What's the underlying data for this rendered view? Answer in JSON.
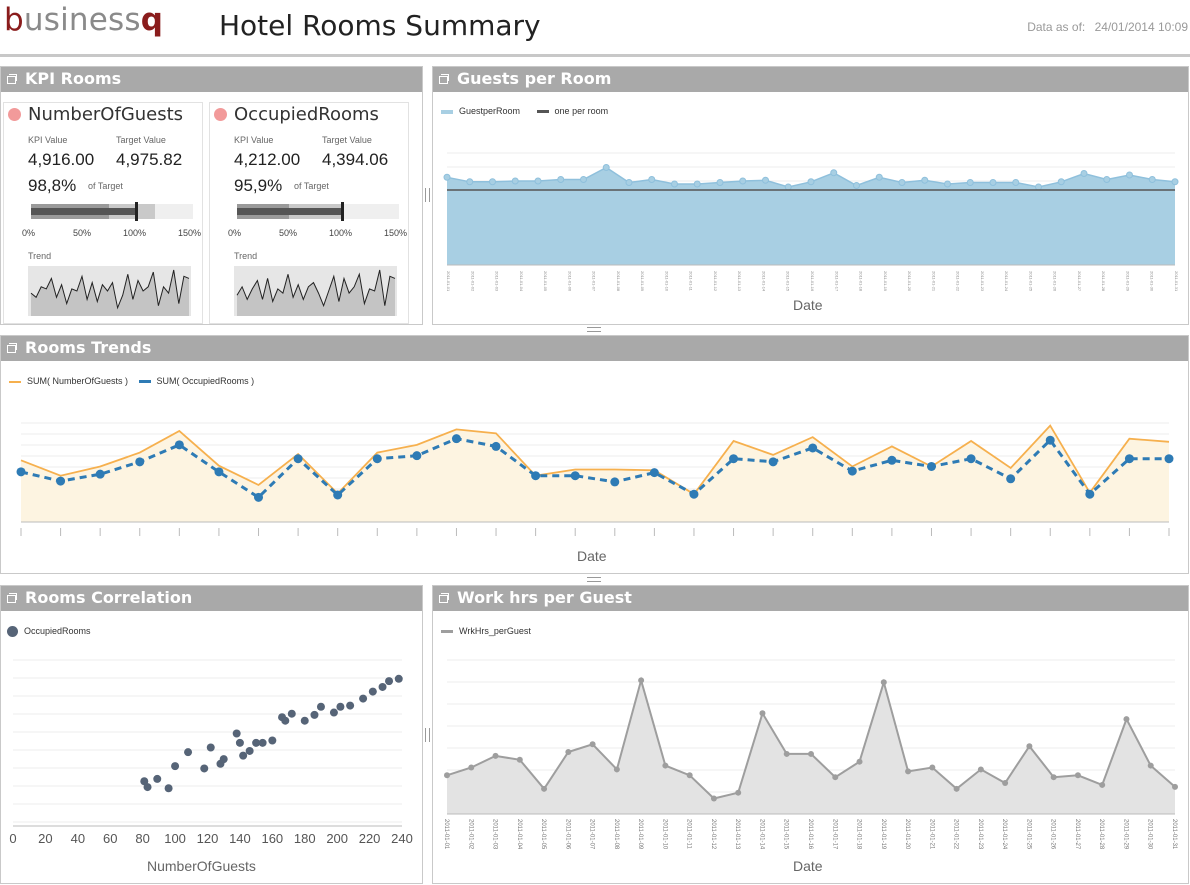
{
  "header": {
    "logo_b": "b",
    "logo_mid": "usiness",
    "logo_q": "q",
    "title": "Hotel Rooms Summary",
    "asof_label": "Data as of:",
    "asof_value": "24/01/2014 10:09"
  },
  "colors": {
    "panel_header": "#a9a9a9",
    "area_blue": "#a8cfe3",
    "line_blue": "#2e7bb5",
    "line_orange": "#f6b04e",
    "kpi_alert": "#f29a9a",
    "scatter_dot": "#566477",
    "gray_series": "#9e9e9e"
  },
  "kpi_panel": {
    "title": "KPI Rooms",
    "value_label": "KPI Value",
    "target_label": "Target Value",
    "of_target_label": "of Target",
    "trend_label": "Trend",
    "axis_ticks": [
      "0%",
      "50%",
      "100%",
      "150%"
    ],
    "cards": [
      {
        "name": "NumberOfGuests",
        "kpi_value": "4,916.00",
        "target_value": "4,975.82",
        "pct_of_target": "98,8%",
        "achievement_fraction": 0.988,
        "trend": [
          0.45,
          0.35,
          0.6,
          0.55,
          0.8,
          0.35,
          0.65,
          0.2,
          0.55,
          0.5,
          0.85,
          0.3,
          0.7,
          0.25,
          0.65,
          0.5,
          0.7,
          0.1,
          0.4,
          0.9,
          0.3,
          0.75,
          0.5,
          0.6,
          0.95,
          0.15,
          0.6,
          0.45,
          1.0,
          0.2,
          0.85,
          0.8
        ]
      },
      {
        "name": "OccupiedRooms",
        "kpi_value": "4,212.00",
        "target_value": "4,394.06",
        "pct_of_target": "95,9%",
        "achievement_fraction": 0.959,
        "trend": [
          0.4,
          0.6,
          0.3,
          0.55,
          0.75,
          0.3,
          0.8,
          0.25,
          0.55,
          0.45,
          0.9,
          0.35,
          0.65,
          0.3,
          0.6,
          0.7,
          0.45,
          0.15,
          0.5,
          0.85,
          0.25,
          0.8,
          0.45,
          0.6,
          0.9,
          0.2,
          0.55,
          0.5,
          1.0,
          0.15,
          0.85,
          0.8
        ]
      }
    ]
  },
  "guests_per_room": {
    "title": "Guests per Room",
    "legend_series": "GuestperRoom",
    "legend_ref": "one per room",
    "xlabel": "Date"
  },
  "rooms_trends": {
    "title": "Rooms Trends",
    "legend_a": "SUM( NumberOfGuests )",
    "legend_b": "SUM( OccupiedRooms )",
    "xlabel": "Date"
  },
  "rooms_correlation": {
    "title": "Rooms Correlation",
    "legend": "OccupiedRooms",
    "xlabel": "NumberOfGuests"
  },
  "work_hrs": {
    "title": "Work hrs per Guest",
    "legend": "WrkHrs_perGuest",
    "xlabel": "Date"
  },
  "chart_data": [
    {
      "type": "area",
      "chart": "guests_per_room",
      "x": [
        "2011-01-01",
        "2011-01-02",
        "2011-01-03",
        "2011-01-04",
        "2011-01-05",
        "2011-01-06",
        "2011-01-07",
        "2011-01-08",
        "2011-01-09",
        "2011-01-10",
        "2011-01-11",
        "2011-01-12",
        "2011-01-13",
        "2011-01-14",
        "2011-01-15",
        "2011-01-16",
        "2011-01-17",
        "2011-01-18",
        "2011-01-19",
        "2011-01-20",
        "2011-01-21",
        "2011-01-22",
        "2011-01-23",
        "2011-01-24",
        "2011-01-25",
        "2011-01-26",
        "2011-01-27",
        "2011-01-28",
        "2011-01-29",
        "2011-01-30",
        "2011-01-31"
      ],
      "series": [
        {
          "name": "GuestperRoom",
          "values": [
            1.17,
            1.11,
            1.11,
            1.12,
            1.12,
            1.14,
            1.14,
            1.3,
            1.1,
            1.14,
            1.08,
            1.08,
            1.1,
            1.12,
            1.13,
            1.04,
            1.11,
            1.23,
            1.06,
            1.17,
            1.1,
            1.13,
            1.08,
            1.1,
            1.1,
            1.1,
            1.04,
            1.11,
            1.22,
            1.14,
            1.2,
            1.14,
            1.11
          ]
        },
        {
          "name": "one per room",
          "values": [
            1.0
          ]
        }
      ],
      "ylim": [
        0,
        1.6
      ]
    },
    {
      "type": "line",
      "chart": "rooms_trends",
      "series": [
        {
          "name": "SUM( NumberOfGuests )",
          "values": [
            170,
            150,
            162,
            180,
            208,
            163,
            138,
            178,
            127,
            180,
            190,
            210,
            205,
            150,
            158,
            158,
            157,
            126,
            195,
            177,
            200,
            162,
            188,
            162,
            195,
            160,
            215,
            128,
            198,
            194
          ]
        },
        {
          "name": "SUM( OccupiedRooms )",
          "values": [
            155,
            143,
            152,
            168,
            190,
            155,
            122,
            172,
            125,
            172,
            176,
            198,
            188,
            150,
            150,
            142,
            154,
            126,
            172,
            168,
            186,
            156,
            170,
            162,
            172,
            146,
            196,
            126,
            172,
            172
          ]
        }
      ],
      "xlabel": "Date"
    },
    {
      "type": "scatter",
      "chart": "rooms_correlation",
      "xlabel": "NumberOfGuests",
      "xlim": [
        0,
        240
      ],
      "xticks": [
        0,
        20,
        40,
        60,
        80,
        100,
        120,
        140,
        160,
        180,
        200,
        220,
        240
      ],
      "series": [
        {
          "name": "OccupiedRooms",
          "points": [
            [
              81,
              95
            ],
            [
              83,
              90
            ],
            [
              89,
              97
            ],
            [
              96,
              89
            ],
            [
              100,
              108
            ],
            [
              108,
              120
            ],
            [
              118,
              106
            ],
            [
              122,
              124
            ],
            [
              128,
              110
            ],
            [
              130,
              114
            ],
            [
              138,
              136
            ],
            [
              140,
              128
            ],
            [
              142,
              117
            ],
            [
              146,
              121
            ],
            [
              150,
              128
            ],
            [
              154,
              128
            ],
            [
              160,
              130
            ],
            [
              166,
              150
            ],
            [
              168,
              147
            ],
            [
              172,
              153
            ],
            [
              180,
              147
            ],
            [
              186,
              152
            ],
            [
              190,
              159
            ],
            [
              198,
              154
            ],
            [
              202,
              159
            ],
            [
              208,
              160
            ],
            [
              216,
              166
            ],
            [
              222,
              172
            ],
            [
              228,
              176
            ],
            [
              232,
              181
            ],
            [
              238,
              183
            ]
          ]
        }
      ]
    },
    {
      "type": "area",
      "chart": "work_hrs",
      "x": [
        "2011-01-01",
        "2011-01-02",
        "2011-01-03",
        "2011-01-04",
        "2011-01-05",
        "2011-01-06",
        "2011-01-07",
        "2011-01-08",
        "2011-01-09",
        "2011-01-10",
        "2011-01-11",
        "2011-01-12",
        "2011-01-13",
        "2011-01-14",
        "2011-01-15",
        "2011-01-16",
        "2011-01-17",
        "2011-01-18",
        "2011-01-19",
        "2011-01-20",
        "2011-01-21",
        "2011-01-22",
        "2011-01-23",
        "2011-01-24",
        "2011-01-25",
        "2011-01-26",
        "2011-01-27",
        "2011-01-28",
        "2011-01-29",
        "2011-01-30",
        "2011-01-31"
      ],
      "series": [
        {
          "name": "WrkHrs_perGuest",
          "values": [
            0.4,
            0.44,
            0.5,
            0.48,
            0.33,
            0.52,
            0.56,
            0.43,
            0.89,
            0.45,
            0.4,
            0.28,
            0.31,
            0.72,
            0.51,
            0.51,
            0.39,
            0.47,
            0.88,
            0.42,
            0.44,
            0.33,
            0.43,
            0.36,
            0.55,
            0.39,
            0.4,
            0.35,
            0.69,
            0.45,
            0.34
          ]
        }
      ]
    }
  ]
}
